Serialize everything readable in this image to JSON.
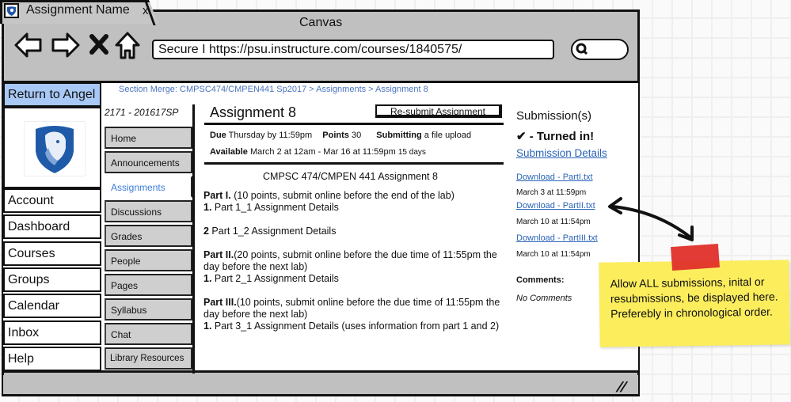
{
  "browser": {
    "tab_title": "Assignment Name",
    "tab_close": "x",
    "window_title": "Canvas",
    "url": "Secure I https://psu.instructure.com/courses/1840575/",
    "nav_icons": [
      "back-arrow-icon",
      "forward-arrow-icon",
      "stop-icon",
      "home-icon"
    ],
    "search_icon": "search-icon"
  },
  "global_nav": {
    "return_label": "Return to Angel",
    "items": [
      "Account",
      "Dashboard",
      "Courses",
      "Groups",
      "Calendar",
      "Inbox",
      "Help"
    ]
  },
  "breadcrumb": "Section Merge: CMPSC474/CMPEN441 Sp2017 > Assignments > Assignment 8",
  "course_nav": {
    "code": "2171 - 201617SP",
    "items": [
      "Home",
      "Announcements",
      "Assignments",
      "Discussions",
      "Grades",
      "People",
      "Pages",
      "Syllabus",
      "Chat",
      "Library Resources"
    ],
    "active": "Assignments"
  },
  "assignment": {
    "title": "Assignment 8",
    "resubmit_label": "Re-submit Assignment",
    "due_label": "Due",
    "due_value": "Thursday by 11:59pm",
    "points_label": "Points",
    "points_value": "30",
    "submitting_label": "Submitting",
    "submitting_value": "a file upload",
    "available_label": "Available",
    "available_value": "March 2 at 12am - Mar 16 at 11:59pm",
    "available_days": "15 days",
    "desc_title": "CMPSC 474/CMPEN 441 Assignment 8",
    "parts": [
      {
        "head": "Part I.",
        "text": " (10 points, submit online before the end of the lab)",
        "items": [
          {
            "num": "1.",
            "text": " Part 1_1 Assignment Details"
          }
        ]
      },
      {
        "head": "",
        "text": "",
        "items": [
          {
            "num": "2",
            "text": " Part 1_2 Assignment Details"
          }
        ]
      },
      {
        "head": "Part II.",
        "text": "(20 points, submit online before the due time of 11:55pm the day before the next lab)",
        "items": [
          {
            "num": "1.",
            "text": " Part 2_1 Assignment Details"
          }
        ]
      },
      {
        "head": "Part III.",
        "text": "(10 points, submit online before the due time of 11:55pm the day before the next lab)",
        "items": [
          {
            "num": "1.",
            "text": " Part 3_1 Assignment Details (uses information from part 1 and 2)"
          }
        ]
      }
    ]
  },
  "submissions": {
    "heading": "Submission(s)",
    "status": "✔ - Turned in!",
    "details_link": "Submission Details",
    "files": [
      {
        "label": "Download - PartI.txt",
        "date": "March 3 at 11:59pm"
      },
      {
        "label": "Download - PartII.txt",
        "date": "March 10 at 11:54pm"
      },
      {
        "label": "Download - PartIII.txt",
        "date": "March 10 at 11:54pm"
      }
    ],
    "comments_label": "Comments:",
    "comments_value": "No Comments"
  },
  "annotation": {
    "note": "Allow ALL submissions, inital or resubmissions, be displayed here. Preferebly in chronological order.",
    "tape_color": "#e0302a",
    "note_color": "#fced5d"
  },
  "colors": {
    "link": "#2a64b8",
    "active_nav": "#3b7ddd",
    "return_button": "#a8c8f5",
    "chrome": "#c0c0c0"
  }
}
